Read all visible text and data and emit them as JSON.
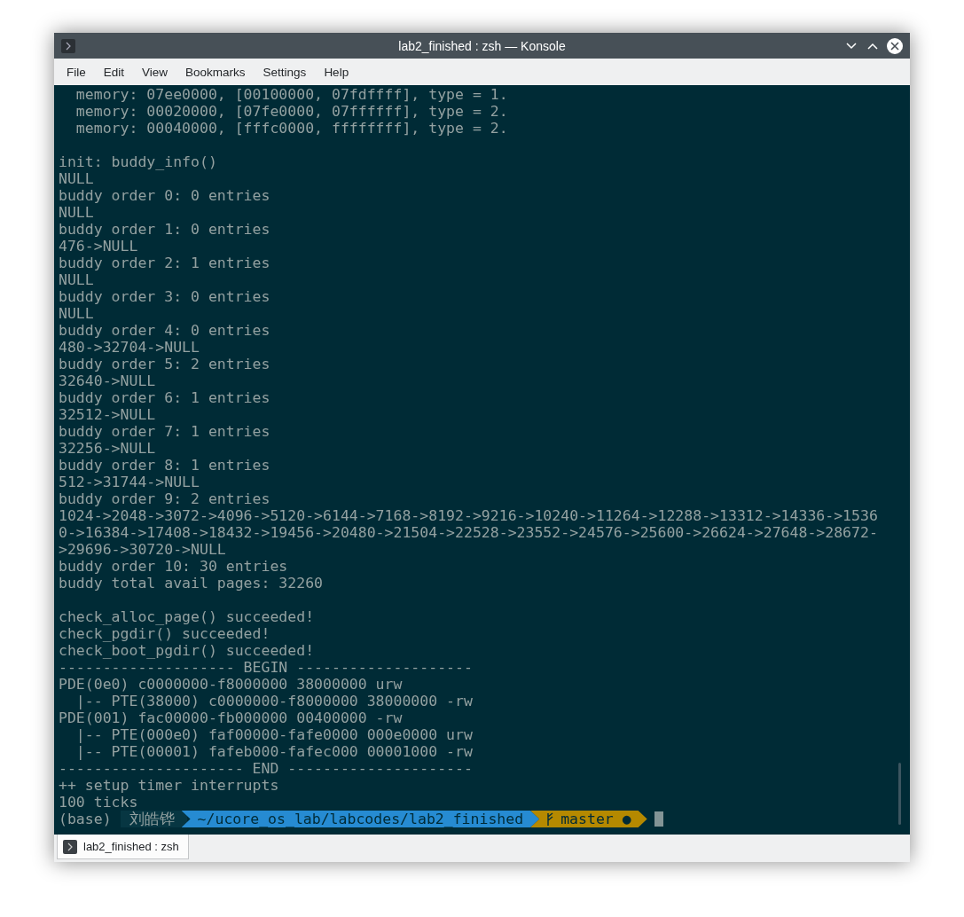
{
  "window": {
    "title": "lab2_finished : zsh — Konsole"
  },
  "menu": [
    "File",
    "Edit",
    "View",
    "Bookmarks",
    "Settings",
    "Help"
  ],
  "terminal": {
    "blocks": [
      [
        "  memory: 07ee0000, [00100000, 07fdffff], type = 1.",
        "  memory: 00020000, [07fe0000, 07ffffff], type = 2.",
        "  memory: 00040000, [fffc0000, ffffffff], type = 2."
      ],
      [
        "init: buddy_info()",
        "NULL",
        "buddy order 0: 0 entries",
        "NULL",
        "buddy order 1: 0 entries",
        "476->NULL",
        "buddy order 2: 1 entries",
        "NULL",
        "buddy order 3: 0 entries",
        "NULL",
        "buddy order 4: 0 entries",
        "480->32704->NULL",
        "buddy order 5: 2 entries",
        "32640->NULL",
        "buddy order 6: 1 entries",
        "32512->NULL",
        "buddy order 7: 1 entries",
        "32256->NULL",
        "buddy order 8: 1 entries",
        "512->31744->NULL",
        "buddy order 9: 2 entries",
        "1024->2048->3072->4096->5120->6144->7168->8192->9216->10240->11264->12288->13312->14336->1536",
        "0->16384->17408->18432->19456->20480->21504->22528->23552->24576->25600->26624->27648->28672-",
        ">29696->30720->NULL",
        "buddy order 10: 30 entries",
        "buddy total avail pages: 32260"
      ],
      [
        "check_alloc_page() succeeded!",
        "check_pgdir() succeeded!",
        "check_boot_pgdir() succeeded!",
        "-------------------- BEGIN --------------------",
        "PDE(0e0) c0000000-f8000000 38000000 urw",
        "  |-- PTE(38000) c0000000-f8000000 38000000 -rw",
        "PDE(001) fac00000-fb000000 00400000 -rw",
        "  |-- PTE(000e0) faf00000-fafe0000 000e0000 urw",
        "  |-- PTE(00001) fafeb000-fafec000 00001000 -rw",
        "--------------------- END ---------------------",
        "++ setup timer interrupts",
        "100 ticks"
      ]
    ],
    "prompt": {
      "env": "(base)",
      "user": "刘皓铧",
      "path": "~/ucore_os_lab/labcodes/lab2_finished",
      "branch": "master ●"
    }
  },
  "tab": {
    "label": "lab2_finished : zsh",
    "selected": true
  }
}
